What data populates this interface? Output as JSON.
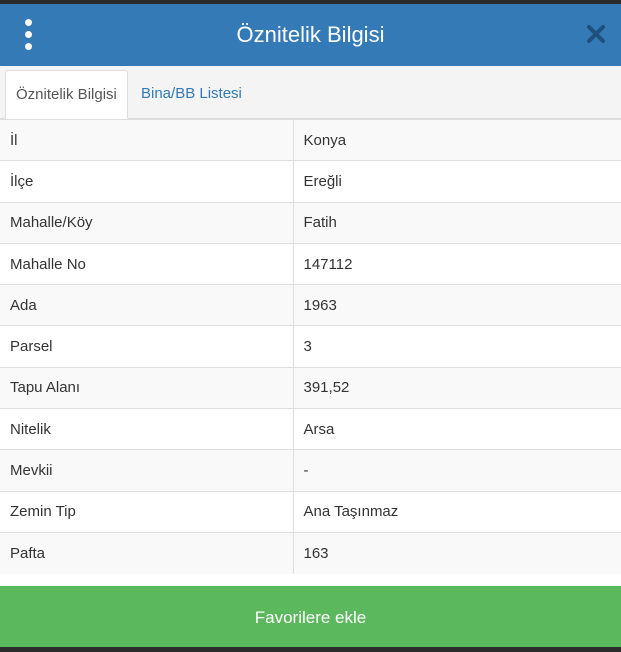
{
  "header": {
    "title": "Öznitelik Bilgisi",
    "menu_icon": "kebab-menu-icon",
    "close_icon": "close-icon",
    "background": "#337ab7"
  },
  "tabs": [
    {
      "label": "Öznitelik Bilgisi",
      "active": true
    },
    {
      "label": "Bina/BB Listesi",
      "active": false
    }
  ],
  "attributes": [
    {
      "key": "İl",
      "value": "Konya"
    },
    {
      "key": "İlçe",
      "value": "Ereğli"
    },
    {
      "key": "Mahalle/Köy",
      "value": "Fatih"
    },
    {
      "key": "Mahalle No",
      "value": "147112"
    },
    {
      "key": "Ada",
      "value": "1963"
    },
    {
      "key": "Parsel",
      "value": "3"
    },
    {
      "key": "Tapu Alanı",
      "value": "391,52"
    },
    {
      "key": "Nitelik",
      "value": "Arsa"
    },
    {
      "key": "Mevkii",
      "value": "-"
    },
    {
      "key": "Zemin Tip",
      "value": "Ana Taşınmaz"
    },
    {
      "key": "Pafta",
      "value": "163"
    }
  ],
  "footer": {
    "button_label": "Favorilere ekle",
    "button_color": "#5cb85c"
  }
}
